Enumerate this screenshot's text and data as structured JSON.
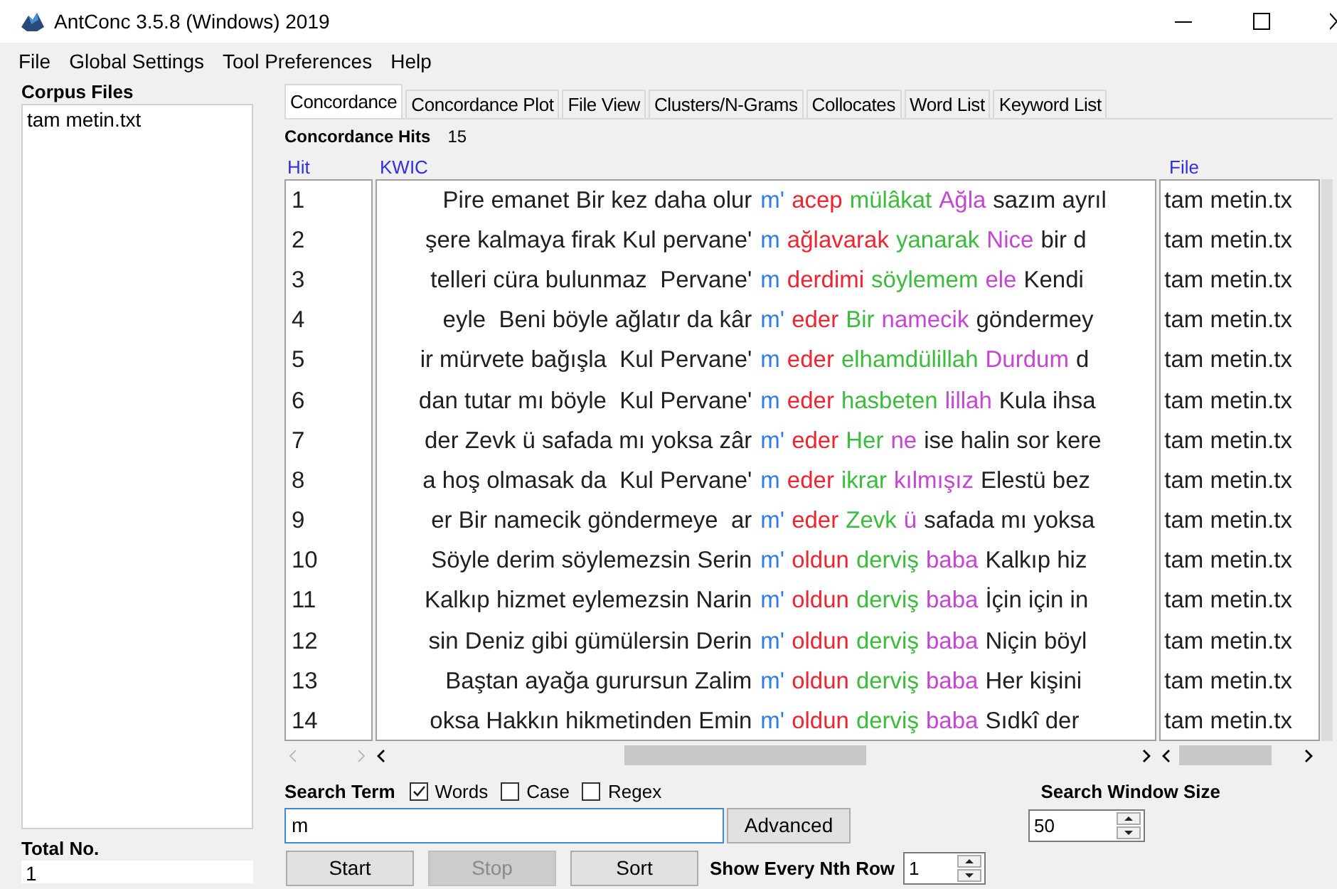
{
  "window": {
    "title": "AntConc 3.5.8 (Windows) 2019"
  },
  "menu": [
    "File",
    "Global Settings",
    "Tool Preferences",
    "Help"
  ],
  "corpus_files": {
    "label": "Corpus Files",
    "files": [
      "tam metin.txt"
    ],
    "total_label": "Total No.",
    "total": "1"
  },
  "tabs": [
    {
      "label": "Concordance",
      "selected": true
    },
    {
      "label": "Concordance Plot",
      "selected": false
    },
    {
      "label": "File View",
      "selected": false
    },
    {
      "label": "Clusters/N-Grams",
      "selected": false
    },
    {
      "label": "Collocates",
      "selected": false
    },
    {
      "label": "Word List",
      "selected": false
    },
    {
      "label": "Keyword List",
      "selected": false
    }
  ],
  "hits": {
    "label": "Concordance Hits",
    "value": "15"
  },
  "table": {
    "columns": [
      "Hit",
      "KWIC",
      "File"
    ],
    "rows": [
      {
        "hit": "1",
        "left": "Pire emanet Bir kez daha olur",
        "segments": [
          {
            "text": "m'",
            "color": "#2f7be8"
          },
          {
            "text": "acep",
            "color": "#ee2530"
          },
          {
            "text": "mülâkat",
            "color": "#3cbc3c"
          },
          {
            "text": "Ağla",
            "color": "#c546d4"
          }
        ],
        "right": "sazım ayrıl",
        "file": "tam metin.tx"
      },
      {
        "hit": "2",
        "left": "şere kalmaya firak Kul pervane'",
        "segments": [
          {
            "text": "m",
            "color": "#2f7be8"
          },
          {
            "text": "ağlavarak",
            "color": "#ee2530"
          },
          {
            "text": "yanarak",
            "color": "#3cbc3c"
          },
          {
            "text": "Nice",
            "color": "#c546d4"
          }
        ],
        "right": "bir d",
        "file": "tam metin.tx"
      },
      {
        "hit": "3",
        "left": "telleri cüra bulunmaz  Pervane'",
        "segments": [
          {
            "text": "m",
            "color": "#2f7be8"
          },
          {
            "text": "derdimi",
            "color": "#ee2530"
          },
          {
            "text": "söylemem",
            "color": "#3cbc3c"
          },
          {
            "text": "ele",
            "color": "#c546d4"
          }
        ],
        "right": "Kendi",
        "file": "tam metin.tx"
      },
      {
        "hit": "4",
        "left": "eyle  Beni böyle ağlatır da kâr",
        "segments": [
          {
            "text": "m'",
            "color": "#2f7be8"
          },
          {
            "text": "eder",
            "color": "#ee2530"
          },
          {
            "text": "Bir",
            "color": "#3cbc3c"
          },
          {
            "text": "namecik",
            "color": "#c546d4"
          }
        ],
        "right": "göndermey",
        "file": "tam metin.tx"
      },
      {
        "hit": "5",
        "left": "ir mürvete bağışla  Kul Pervane'",
        "segments": [
          {
            "text": "m",
            "color": "#2f7be8"
          },
          {
            "text": "eder",
            "color": "#ee2530"
          },
          {
            "text": "elhamdülillah",
            "color": "#3cbc3c"
          },
          {
            "text": "Durdum",
            "color": "#c546d4"
          }
        ],
        "right": "d",
        "file": "tam metin.tx"
      },
      {
        "hit": "6",
        "left": "dan tutar mı böyle  Kul Pervane'",
        "segments": [
          {
            "text": "m",
            "color": "#2f7be8"
          },
          {
            "text": "eder",
            "color": "#ee2530"
          },
          {
            "text": "hasbeten",
            "color": "#3cbc3c"
          },
          {
            "text": "lillah",
            "color": "#c546d4"
          }
        ],
        "right": "Kula ihsa",
        "file": "tam metin.tx"
      },
      {
        "hit": "7",
        "left": "der Zevk ü safada mı yoksa zâr",
        "segments": [
          {
            "text": "m'",
            "color": "#2f7be8"
          },
          {
            "text": "eder",
            "color": "#ee2530"
          },
          {
            "text": "Her",
            "color": "#3cbc3c"
          },
          {
            "text": "ne",
            "color": "#c546d4"
          }
        ],
        "right": "ise halin sor kere",
        "file": "tam metin.tx"
      },
      {
        "hit": "8",
        "left": "a hoş olmasak da  Kul Pervane'",
        "segments": [
          {
            "text": "m",
            "color": "#2f7be8"
          },
          {
            "text": "eder",
            "color": "#ee2530"
          },
          {
            "text": "ikrar",
            "color": "#3cbc3c"
          },
          {
            "text": "kılmışız",
            "color": "#c546d4"
          }
        ],
        "right": "Elestü bez",
        "file": "tam metin.tx"
      },
      {
        "hit": "9",
        "left": "er Bir namecik göndermeye  ar",
        "segments": [
          {
            "text": "m'",
            "color": "#2f7be8"
          },
          {
            "text": "eder",
            "color": "#ee2530"
          },
          {
            "text": "Zevk",
            "color": "#3cbc3c"
          },
          {
            "text": "ü",
            "color": "#c546d4"
          }
        ],
        "right": "safada mı yoksa",
        "file": "tam metin.tx"
      },
      {
        "hit": "10",
        "left": "Söyle derim söylemezsin Serin",
        "segments": [
          {
            "text": "m'",
            "color": "#2f7be8"
          },
          {
            "text": "oldun",
            "color": "#ee2530"
          },
          {
            "text": "derviş",
            "color": "#3cbc3c"
          },
          {
            "text": "baba",
            "color": "#c546d4"
          }
        ],
        "right": "Kalkıp hiz",
        "file": "tam metin.tx"
      },
      {
        "hit": "11",
        "left": "Kalkıp hizmet eylemezsin Narin",
        "segments": [
          {
            "text": "m'",
            "color": "#2f7be8"
          },
          {
            "text": "oldun",
            "color": "#ee2530"
          },
          {
            "text": "derviş",
            "color": "#3cbc3c"
          },
          {
            "text": "baba",
            "color": "#c546d4"
          }
        ],
        "right": "İçin için in",
        "file": "tam metin.tx"
      },
      {
        "hit": "12",
        "left": "sin Deniz gibi gümülersin Derin",
        "segments": [
          {
            "text": "m'",
            "color": "#2f7be8"
          },
          {
            "text": "oldun",
            "color": "#ee2530"
          },
          {
            "text": "derviş",
            "color": "#3cbc3c"
          },
          {
            "text": "baba",
            "color": "#c546d4"
          }
        ],
        "right": "Niçin böyl",
        "file": "tam metin.tx"
      },
      {
        "hit": "13",
        "left": "Baştan ayağa gurursun Zalim",
        "segments": [
          {
            "text": "m'",
            "color": "#2f7be8"
          },
          {
            "text": "oldun",
            "color": "#ee2530"
          },
          {
            "text": "derviş",
            "color": "#3cbc3c"
          },
          {
            "text": "baba",
            "color": "#c546d4"
          }
        ],
        "right": "Her kişini",
        "file": "tam metin.tx"
      },
      {
        "hit": "14",
        "left": "oksa Hakkın hikmetinden Emin",
        "segments": [
          {
            "text": "m'",
            "color": "#2f7be8"
          },
          {
            "text": "oldun",
            "color": "#ee2530"
          },
          {
            "text": "derviş",
            "color": "#3cbc3c"
          },
          {
            "text": "baba",
            "color": "#c546d4"
          }
        ],
        "right": "Sıdkî der",
        "file": "tam metin.tx"
      }
    ]
  },
  "search": {
    "label": "Search Term",
    "options": [
      {
        "label": "Words",
        "checked": true
      },
      {
        "label": "Case",
        "checked": false
      },
      {
        "label": "Regex",
        "checked": false
      }
    ],
    "value": "m",
    "advanced": "Advanced",
    "window_size_label": "Search Window Size",
    "window_size": "50"
  },
  "buttons": [
    {
      "label": "Start",
      "disabled": false
    },
    {
      "label": "Stop",
      "disabled": true
    },
    {
      "label": "Sort",
      "disabled": false
    }
  ],
  "nth_row": {
    "label": "Show Every Nth Row",
    "value": "1"
  }
}
